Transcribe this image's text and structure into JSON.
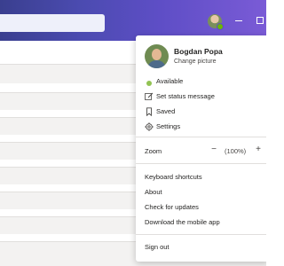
{
  "profile": {
    "name": "Bogdan Popa",
    "change_picture": "Change picture"
  },
  "status_items": [
    {
      "label": "Available",
      "icon": "presence-available-icon",
      "color": "#92c353"
    },
    {
      "label": "Set status message",
      "icon": "edit-icon"
    },
    {
      "label": "Saved",
      "icon": "bookmark-icon"
    },
    {
      "label": "Settings",
      "icon": "gear-icon"
    }
  ],
  "zoom": {
    "label": "Zoom",
    "minus": "−",
    "value": "(100%)",
    "plus": "+"
  },
  "help_items": [
    {
      "label": "Keyboard shortcuts"
    },
    {
      "label": "About"
    },
    {
      "label": "Check for updates"
    },
    {
      "label": "Download the mobile app"
    }
  ],
  "sign_out": "Sign out",
  "colors": {
    "titlebar_accent": "#5e4ec6",
    "available_green": "#92c353"
  }
}
